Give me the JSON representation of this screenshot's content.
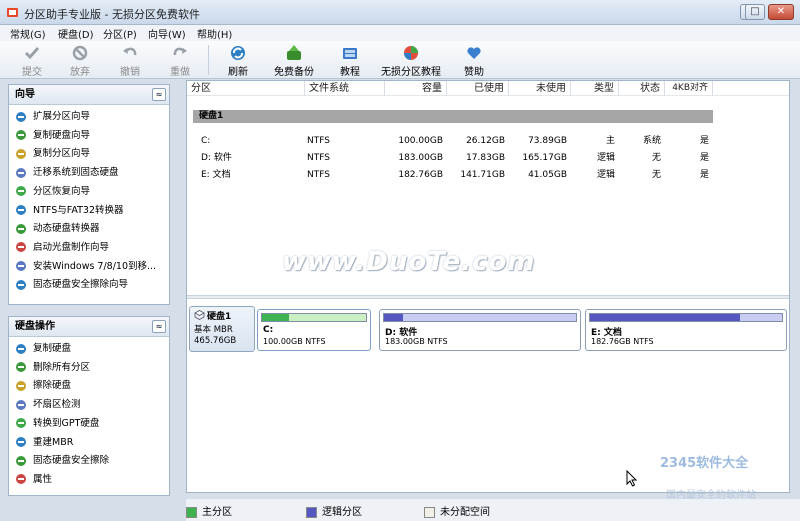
{
  "window": {
    "title": "分区助手专业版 - 无损分区免费软件"
  },
  "menu": [
    "常规(G)",
    "硬盘(D)",
    "分区(P)",
    "向导(W)",
    "帮助(H)"
  ],
  "toolbar": {
    "undo": {
      "label": "提交",
      "icon": "check-icon"
    },
    "discard": {
      "label": "放弃",
      "icon": "discard-icon"
    },
    "revoke": {
      "label": "撤销",
      "icon": "undo-icon"
    },
    "redo": {
      "label": "重做",
      "icon": "redo-icon"
    },
    "refresh": {
      "label": "刷新",
      "icon": "refresh-icon"
    },
    "backup": {
      "label": "免费备份",
      "icon": "backup-icon"
    },
    "tutorial": {
      "label": "教程",
      "icon": "tutorial-icon"
    },
    "lossless_tutorial": {
      "label": "无损分区教程",
      "icon": "lossless-icon"
    },
    "sponsor": {
      "label": "赞助",
      "icon": "heart-icon"
    }
  },
  "wizard_panel": {
    "title": "向导",
    "items": [
      "扩展分区向导",
      "复制硬盘向导",
      "复制分区向导",
      "迁移系统到固态硬盘",
      "分区恢复向导",
      "NTFS与FAT32转换器",
      "动态硬盘转换器",
      "启动光盘制作向导",
      "安装Windows 7/8/10到移...",
      "固态硬盘安全擦除向导"
    ]
  },
  "disk_panel": {
    "title": "硬盘操作",
    "items": [
      "复制硬盘",
      "删除所有分区",
      "擦除硬盘",
      "坏扇区检测",
      "转换到GPT硬盘",
      "重建MBR",
      "固态硬盘安全擦除",
      "属性"
    ]
  },
  "table": {
    "columns": [
      "分区",
      "文件系统",
      "容量",
      "已使用",
      "未使用",
      "类型",
      "状态",
      "4KB对齐"
    ],
    "group": "硬盘1",
    "rows": [
      {
        "name": "C:",
        "fs": "NTFS",
        "cap": "100.00GB",
        "used": "26.12GB",
        "free": "73.89GB",
        "type": "主",
        "status": "系统",
        "align": "是"
      },
      {
        "name": "D: 软件",
        "fs": "NTFS",
        "cap": "183.00GB",
        "used": "17.83GB",
        "free": "165.17GB",
        "type": "逻辑",
        "status": "无",
        "align": "是"
      },
      {
        "name": "E: 文档",
        "fs": "NTFS",
        "cap": "182.76GB",
        "used": "141.71GB",
        "free": "41.05GB",
        "type": "逻辑",
        "status": "无",
        "align": "是"
      }
    ]
  },
  "diskmap": {
    "disk": {
      "name": "硬盘1",
      "kind": "基本 MBR",
      "size": "465.76GB"
    },
    "partitions": [
      {
        "label": "C:",
        "sub": "100.00GB NTFS",
        "used": 0.26,
        "color": "#3fb34f"
      },
      {
        "label": "D: 软件",
        "sub": "183.00GB NTFS",
        "used": 0.1,
        "color": "#5558c0"
      },
      {
        "label": "E: 文档",
        "sub": "182.76GB NTFS",
        "used": 0.78,
        "color": "#5558c0"
      }
    ]
  },
  "legend": [
    {
      "label": "主分区",
      "color": "#3fb34f"
    },
    {
      "label": "逻辑分区",
      "color": "#5558c0"
    },
    {
      "label": "未分配空间",
      "color": "#f2f0e6"
    }
  ],
  "watermarks": {
    "main": "www.DuoTe.com",
    "brand": "2345软件大全",
    "sub": "国内最安全的软件站"
  },
  "window_controls": {
    "minimize": "—",
    "maximize": "□",
    "close": "✕"
  },
  "panel_collapse_glyph": "≈"
}
